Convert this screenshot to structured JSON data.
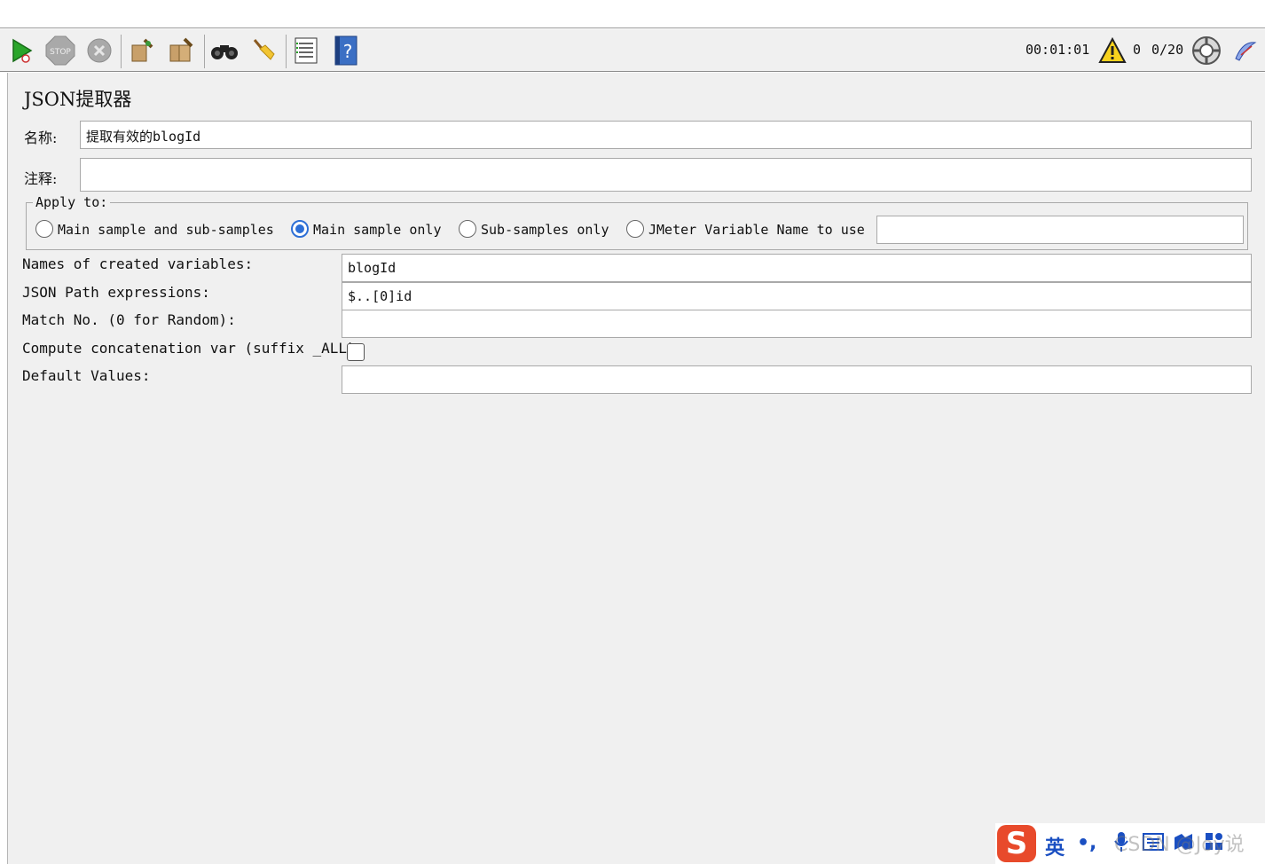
{
  "toolbar": {
    "timer": "00:01:01",
    "warn_count": "0",
    "threads": "0/20",
    "icons": [
      "start-icon",
      "stop-icon",
      "shutdown-icon",
      "clear-icon",
      "clear-all-icon",
      "search-icon",
      "reset-search-icon",
      "function-helper-icon",
      "help-icon",
      "warning-icon",
      "remote-icon",
      "log-icon"
    ]
  },
  "panel": {
    "title": "JSON提取器",
    "name_label": "名称:",
    "name_value": "提取有效的blogId",
    "comment_label": "注释:",
    "comment_value": ""
  },
  "apply_to": {
    "legend": "Apply to:",
    "options": [
      {
        "label": "Main sample and sub-samples",
        "selected": false
      },
      {
        "label": "Main sample only",
        "selected": true
      },
      {
        "label": "Sub-samples only",
        "selected": false
      },
      {
        "label": "JMeter Variable Name to use",
        "selected": false
      }
    ],
    "variable_value": ""
  },
  "form": {
    "names_label": "Names of created variables:",
    "names_value": "blogId",
    "jsonpath_label": "JSON Path expressions:",
    "jsonpath_value": "$..[0]id",
    "match_label": "Match No. (0 for Random):",
    "match_value": "",
    "concat_label": "Compute concatenation var (suffix _ALL):",
    "concat_checked": false,
    "default_label": "Default Values:",
    "default_value": ""
  },
  "ime": {
    "logo": "S",
    "mode": "英",
    "punct": "•,",
    "watermark": "CSDN @Joy说"
  },
  "colors": {
    "accent": "#2d6fd6",
    "panel_bg": "#f0f0f0",
    "ime_brand": "#e84a2b"
  }
}
